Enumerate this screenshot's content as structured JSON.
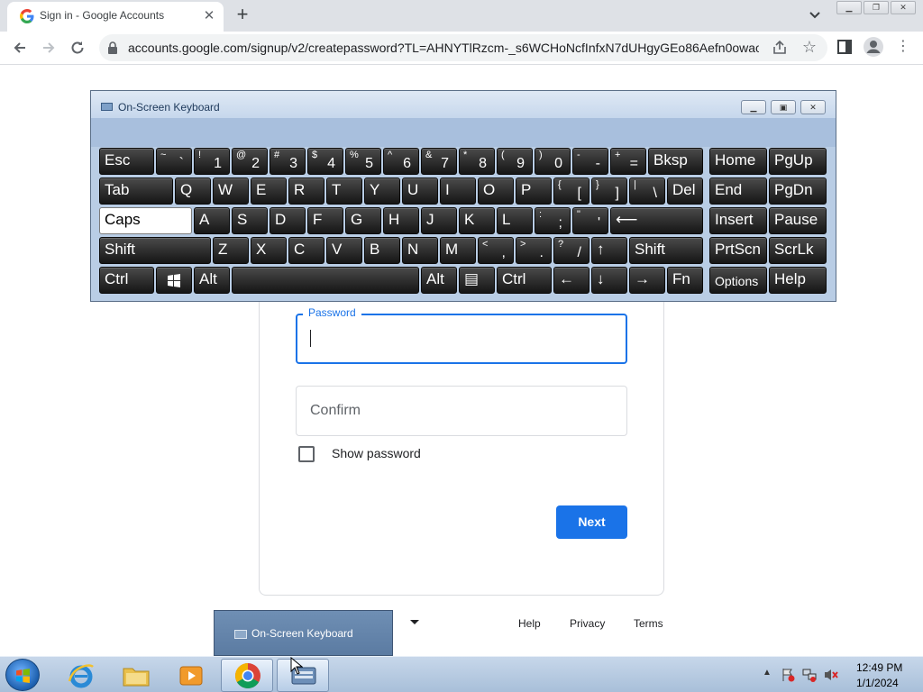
{
  "browser": {
    "tab_title": "Sign in - Google Accounts",
    "url": "accounts.google.com/signup/v2/createpassword?TL=AHNYTlRzcm-_s6WCHoNcfInfxN7dUHgyGEo86Aefn0owao..."
  },
  "form": {
    "password_label": "Password",
    "confirm_placeholder": "Confirm",
    "show_password_label": "Show password",
    "next_label": "Next"
  },
  "footer": {
    "links": [
      "Help",
      "Privacy",
      "Terms"
    ]
  },
  "osk": {
    "title": "On-Screen Keyboard"
  },
  "taskbar": {
    "preview_label": "On-Screen Keyboard",
    "time": "12:49 PM",
    "date": "1/1/2024"
  },
  "colors": {
    "accent": "#1a73e8",
    "key_face": "#1a1a1a",
    "osk_body": "#b9cde5"
  }
}
